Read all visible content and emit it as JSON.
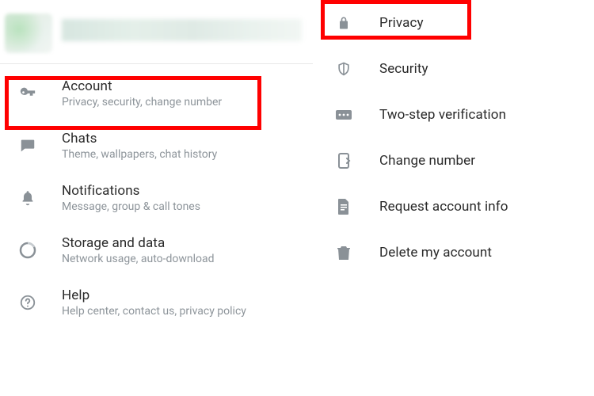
{
  "settings": {
    "items": [
      {
        "title": "Account",
        "subtitle": "Privacy, security, change number"
      },
      {
        "title": "Chats",
        "subtitle": "Theme, wallpapers, chat history"
      },
      {
        "title": "Notifications",
        "subtitle": "Message, group & call tones"
      },
      {
        "title": "Storage and data",
        "subtitle": "Network usage, auto-download"
      },
      {
        "title": "Help",
        "subtitle": "Help center, contact us, privacy policy"
      }
    ]
  },
  "account_submenu": {
    "items": [
      {
        "title": "Privacy"
      },
      {
        "title": "Security"
      },
      {
        "title": "Two-step verification"
      },
      {
        "title": "Change number"
      },
      {
        "title": "Request account info"
      },
      {
        "title": "Delete my account"
      }
    ]
  }
}
